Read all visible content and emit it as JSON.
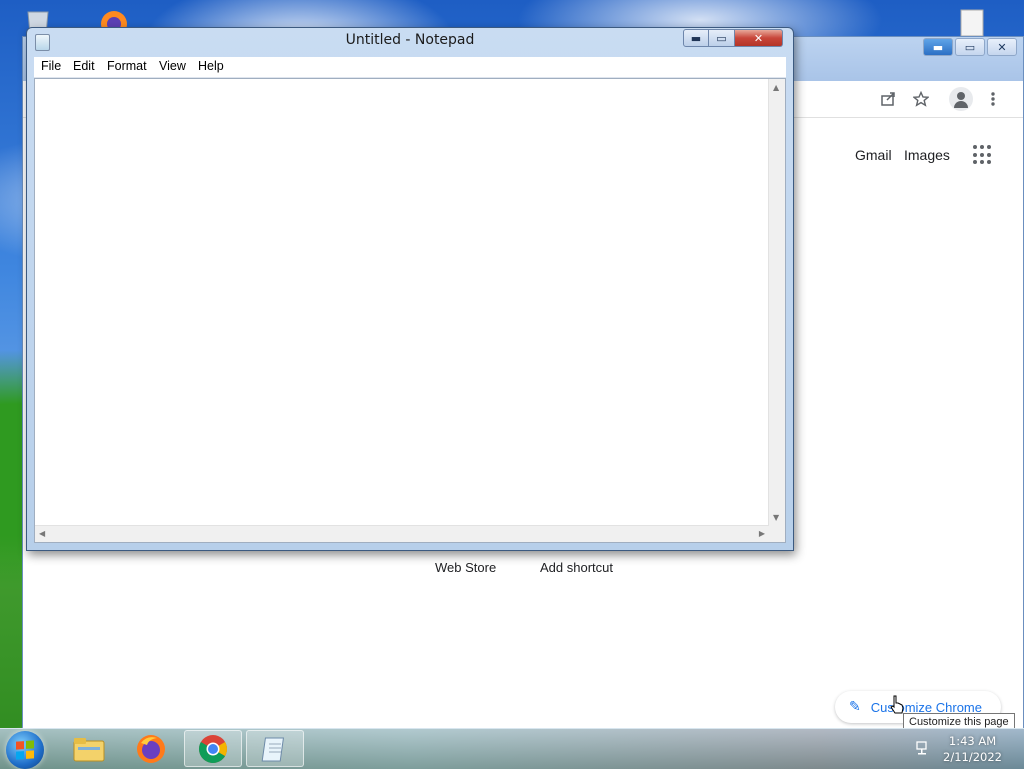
{
  "notepad": {
    "title": "Untitled - Notepad",
    "menu": [
      "File",
      "Edit",
      "Format",
      "View",
      "Help"
    ],
    "caption_buttons": {
      "minimize": "▬",
      "maximize": "▭",
      "close": "✕"
    }
  },
  "chrome": {
    "caption_buttons": {
      "minimize": "▬",
      "maximize": "▭",
      "close": "✕"
    },
    "top_links": {
      "gmail": "Gmail",
      "images": "Images"
    },
    "shortcuts": {
      "web_store": "Web Store",
      "add_shortcut": "Add shortcut"
    },
    "customize_button": "Customize Chrome",
    "tooltip": "Customize this page",
    "toolbar_icons": [
      "share-icon",
      "star-icon",
      "profile-icon",
      "menu-icon"
    ]
  },
  "taskbar": {
    "items": [
      "file-explorer-icon",
      "firefox-icon",
      "chrome-icon",
      "notepad-icon"
    ],
    "clock_time": "1:43 AM",
    "clock_date": "2/11/2022"
  },
  "colors": {
    "chrome_link_blue": "#1a73e8",
    "close_red": "#c8463a"
  }
}
